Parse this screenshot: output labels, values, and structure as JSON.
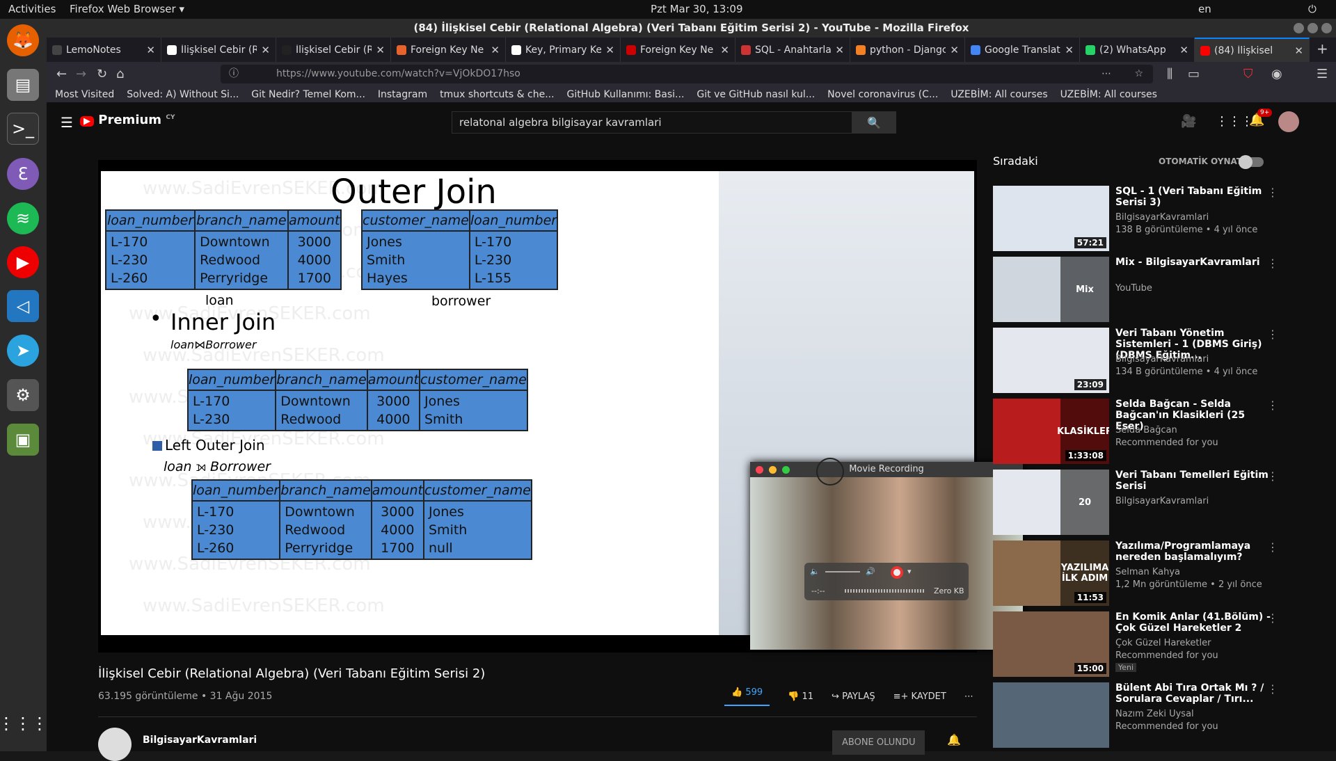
{
  "system": {
    "activities": "Activities",
    "app": "Firefox Web Browser",
    "clock": "Pzt Mar 30, 13:09",
    "lang": "en"
  },
  "window": {
    "title": "(84) İlişkisel Cebir (Relational Algebra) (Veri Tabanı Eğitim Serisi 2) - YouTube - Mozilla Firefox"
  },
  "tabs": [
    {
      "label": "LemoNotes",
      "color": "#444"
    },
    {
      "label": "İlişkisel Cebir (Rela",
      "color": "#fff"
    },
    {
      "label": "İlişkisel Cebir (R",
      "color": "#222"
    },
    {
      "label": "Foreign Key Ne",
      "color": "#e8632c"
    },
    {
      "label": "Key, Primary Key, U",
      "color": "#fff"
    },
    {
      "label": "Foreign Key Ne",
      "color": "#c00"
    },
    {
      "label": "SQL - Anahtarla",
      "color": "#c33"
    },
    {
      "label": "python - Djangc",
      "color": "#f48024"
    },
    {
      "label": "Google Translat",
      "color": "#4285f4"
    },
    {
      "label": "(2) WhatsApp",
      "color": "#25d366"
    },
    {
      "label": "(84) İlişkisel",
      "color": "#f00"
    }
  ],
  "nav": {
    "url": "https://www.youtube.com/watch?v=VjOkDO17hso"
  },
  "bookmarks": [
    "Most Visited",
    "Solved: A) Without Si...",
    "Git Nedir? Temel Kom...",
    "Instagram",
    "tmux shortcuts & che...",
    "GitHub Kullanımı: Basi...",
    "Git ve GitHub nasıl kul...",
    "Novel coronavirus (C...",
    "UZEBİM: All courses",
    "UZEBİM: All courses"
  ],
  "youtube": {
    "logo": "Premium",
    "region": "CY",
    "search_value": "relatonal algebra bilgisayar kavramlari",
    "notif_count": "9+"
  },
  "slide": {
    "title": "Outer Join",
    "loan_headers": [
      "loan_number",
      "branch_name",
      "amount"
    ],
    "loan_col1": "L-170\nL-230\nL-260",
    "loan_col2": "Downtown\nRedwood\nPerryridge",
    "loan_col3": "3000\n4000\n1700",
    "borrower_headers": [
      "customer_name",
      "loan_number"
    ],
    "borrower_col1": "Jones\nSmith\nHayes",
    "borrower_col2": "L-170\nL-230\nL-155",
    "loan_caption": "loan",
    "borrower_caption": "borrower",
    "inner_bullet": "•",
    "inner_title": "Inner Join",
    "inner_expr_left": "loan",
    "inner_expr_right": "Borrower",
    "inner_headers": [
      "loan_number",
      "branch_name",
      "amount",
      "customer_name"
    ],
    "inner_col1": "L-170\nL-230",
    "inner_col2": "Downtown\nRedwood",
    "inner_col3": "3000\n4000",
    "inner_col4": "Jones\nSmith",
    "left_title": "Left Outer Join",
    "left_expr_left": "loan",
    "left_expr_right": "Borrower",
    "left_headers": [
      "loan_number",
      "branch_name",
      "amount",
      "customer_name"
    ],
    "left_col1": "L-170\nL-230\nL-260",
    "left_col2": "Downtown\nRedwood\nPerryridge",
    "left_col3": "3000\n4000\n1700",
    "left_col4": "Jones\nSmith\nnull",
    "watermark": "www.SadiEvrenSEKER.com"
  },
  "movie": {
    "title": "Movie Recording",
    "time": "--:--",
    "size": "Zero KB"
  },
  "video": {
    "title": "İlişkisel Cebir (Relational Algebra) (Veri Tabanı Eğitim Serisi 2)",
    "meta": "63.195 görüntüleme • 31 Ağu 2015",
    "likes": "599",
    "dislikes": "11",
    "share": "PAYLAŞ",
    "save": "KAYDET",
    "channel": "BilgisayarKavramlari",
    "subscribed": "ABONE OLUNDU"
  },
  "sidebar": {
    "heading": "Sıradaki",
    "autoplay": "OTOMATİK OYNAT",
    "items": [
      {
        "title": "SQL - 1 (Veri Tabanı Eğitim Serisi 3)",
        "channel": "BilgisayarKavramlari",
        "meta": "138 B görüntüleme • 4 yıl önce",
        "duration": "57:21",
        "thumb": "#dde4ee"
      },
      {
        "title": "Mix - BilgisayarKavramlari",
        "channel": "YouTube",
        "meta": "",
        "duration": "",
        "overlay": "Mix",
        "thumb": "#cfd6de"
      },
      {
        "title": "Veri Tabanı Yönetim Sistemleri - 1 (DBMS Giriş) (DBMS Eğitim...",
        "channel": "BilgisayarKavramlari",
        "meta": "134 B görüntüleme • 4 yıl önce",
        "duration": "23:09",
        "thumb": "#e4e8ee"
      },
      {
        "title": "Selda Bağcan - Selda Bağcan'ın Klasikleri (25 Eser)",
        "channel": "Selda Bağcan",
        "meta": "Recommended for you",
        "duration": "1:33:08",
        "overlay": "KLASİKLER",
        "thumb": "#b81c1c"
      },
      {
        "title": "Veri Tabanı Temelleri Eğitim Serisi",
        "channel": "BilgisayarKavramlari",
        "meta": "",
        "duration": "",
        "overlay": "20",
        "thumb": "#e4e8ee"
      },
      {
        "title": "Yazılıma/Programlamaya nereden başlamalıyım?",
        "channel": "Selman Kahya",
        "meta": "1,2 Mn görüntüleme • 2 yıl önce",
        "duration": "11:53",
        "overlay": "YAZILIMA İLK ADIM",
        "thumb": "#8a6a4a"
      },
      {
        "title": "En Komik Anlar (41.Bölüm) - Çok Güzel Hareketler 2",
        "channel": "Çok Güzel Hareketler",
        "meta": "Recommended for you",
        "badge": "Yeni",
        "duration": "15:00",
        "thumb": "#7a5a44"
      },
      {
        "title": "Bülent Abi Tıra Ortak Mı ? / Sorulara Cevaplar / Tırı...",
        "channel": "Nazım Zeki Uysal",
        "meta": "Recommended for you",
        "duration": "",
        "thumb": "#556677"
      }
    ]
  }
}
